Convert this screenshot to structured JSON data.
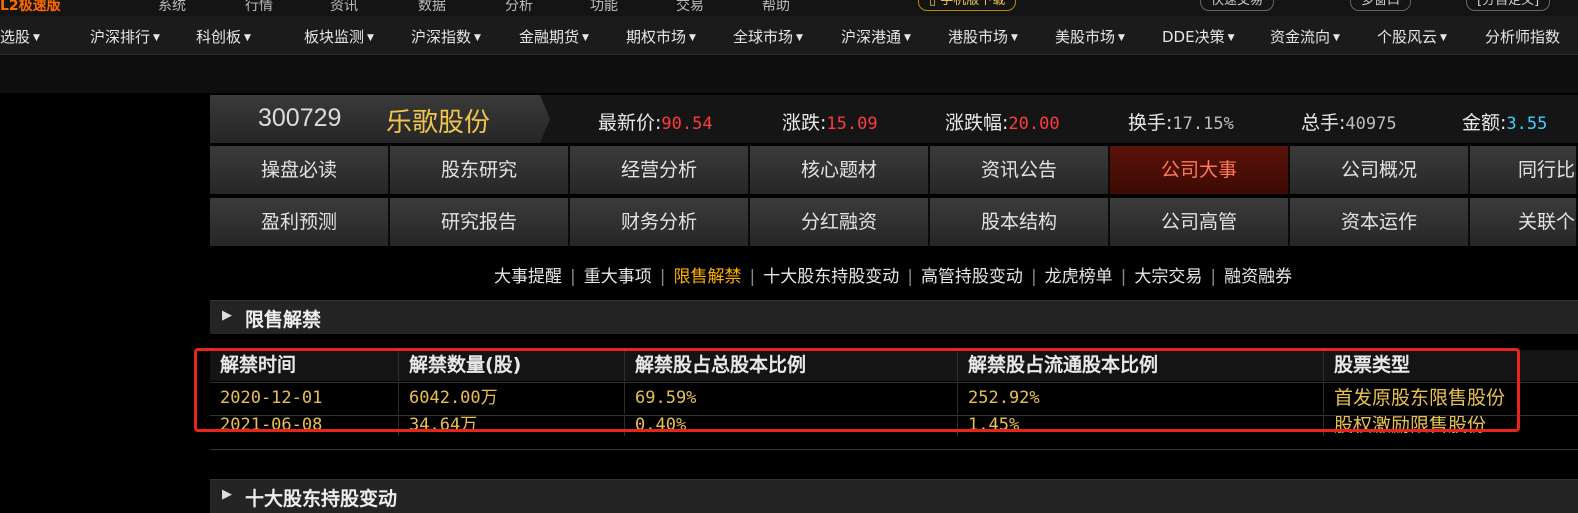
{
  "topbar": {
    "logo": "L2极速版",
    "menus": [
      "系统",
      "行情",
      "资讯",
      "数据",
      "分析",
      "功能",
      "交易",
      "帮助"
    ],
    "mobile_pill": "手机版下载",
    "fast_trade_pill": "快速交易",
    "multi_window_pill": "多窗口",
    "custom_pill": "[分自定义]"
  },
  "menubar": {
    "items": [
      "选股",
      "沪深排行",
      "科创板",
      "板块监测",
      "沪深指数",
      "金融期货",
      "期权市场",
      "全球市场",
      "沪深港通",
      "港股市场",
      "美股市场",
      "DDE决策",
      "资金流向",
      "个股风云",
      "分析师指数"
    ]
  },
  "stock": {
    "code": "300729",
    "name": "乐歌股份",
    "latest_label": "最新价:",
    "latest_value": "90.54",
    "change_label": "涨跌:",
    "change_value": "15.09",
    "pct_label": "涨跌幅:",
    "pct_value": "20.00",
    "turnover_label": "换手:",
    "turnover_value": "17.15%",
    "volume_label": "总手:",
    "volume_value": "40975",
    "amount_label": "金额:",
    "amount_value": "3.55"
  },
  "tabs": {
    "row1": [
      "操盘必读",
      "股东研究",
      "经营分析",
      "核心题材",
      "资讯公告",
      "公司大事",
      "公司概况",
      "同行比较"
    ],
    "row2": [
      "盈利预测",
      "研究报告",
      "财务分析",
      "分红融资",
      "股本结构",
      "公司高管",
      "资本运作",
      "关联个股"
    ],
    "active": "公司大事"
  },
  "subnav": {
    "links": [
      "大事提醒",
      "重大事项",
      "限售解禁",
      "十大股东持股变动",
      "高管持股变动",
      "龙虎榜单",
      "大宗交易",
      "融资融券"
    ],
    "active": "限售解禁"
  },
  "section1": {
    "title": "限售解禁"
  },
  "section2": {
    "title": "十大股东持股变动"
  },
  "table": {
    "headers": [
      "解禁时间",
      "解禁数量(股)",
      "解禁股占总股本比例",
      "解禁股占流通股本比例",
      "股票类型"
    ],
    "rows": [
      [
        "2020-12-01",
        "6042.00万",
        "69.59%",
        "252.92%",
        "首发原股东限售股份"
      ],
      [
        "2021-06-08",
        "34.64万",
        "0.40%",
        "1.45%",
        "股权激励限售股份"
      ]
    ]
  },
  "colors": {
    "accent_red": "#ff3b3b",
    "gold": "#f0c64a",
    "highlight_box": "#e8251a",
    "active_link": "#ffb000"
  }
}
